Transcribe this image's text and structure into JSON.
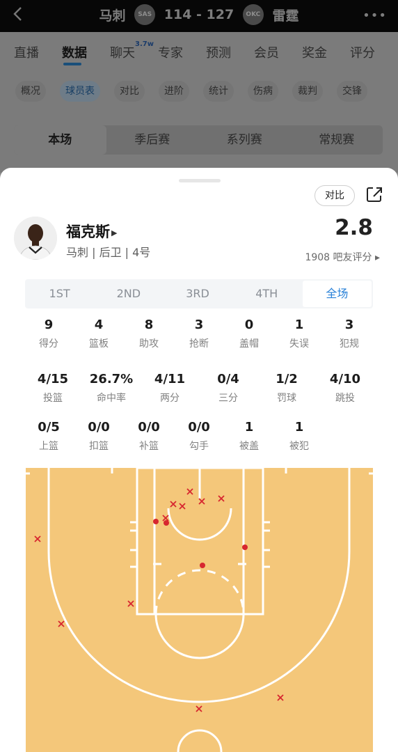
{
  "header": {
    "home_team": "马刺",
    "home_logo": "SAS",
    "score": "114 - 127",
    "away_logo": "OKC",
    "away_team": "雷霆",
    "more_icon": "more-dots-icon",
    "back_icon": "back-arrow-icon"
  },
  "nav_tabs": [
    {
      "label": "直播"
    },
    {
      "label": "数据"
    },
    {
      "label": "聊天",
      "badge": "3.7w"
    },
    {
      "label": "专家"
    },
    {
      "label": "预测"
    },
    {
      "label": "会员"
    },
    {
      "label": "奖金"
    },
    {
      "label": "评分"
    }
  ],
  "sub_tabs": [
    {
      "label": "概况"
    },
    {
      "label": "球员表"
    },
    {
      "label": "对比"
    },
    {
      "label": "进阶"
    },
    {
      "label": "统计"
    },
    {
      "label": "伤病"
    },
    {
      "label": "裁判"
    },
    {
      "label": "交锋"
    }
  ],
  "segments": [
    {
      "label": "本场"
    },
    {
      "label": "季后赛"
    },
    {
      "label": "系列赛"
    },
    {
      "label": "常规赛"
    }
  ],
  "sheet": {
    "compare_label": "对比",
    "share_icon": "share-icon",
    "player": {
      "name": "福克斯",
      "meta": "马刺 | 后卫 | 4号",
      "rating": "2.8",
      "rating_count": "1908 吧友评分 ▸"
    },
    "periods": [
      {
        "label": "1ST"
      },
      {
        "label": "2ND"
      },
      {
        "label": "3RD"
      },
      {
        "label": "4TH"
      },
      {
        "label": "全场"
      }
    ],
    "stats_rows": [
      [
        {
          "value": "9",
          "label": "得分"
        },
        {
          "value": "4",
          "label": "篮板"
        },
        {
          "value": "8",
          "label": "助攻"
        },
        {
          "value": "3",
          "label": "抢断"
        },
        {
          "value": "0",
          "label": "盖帽"
        },
        {
          "value": "1",
          "label": "失误"
        },
        {
          "value": "3",
          "label": "犯规"
        }
      ],
      [
        {
          "value": "4/15",
          "label": "投篮"
        },
        {
          "value": "26.7%",
          "label": "命中率"
        },
        {
          "value": "4/11",
          "label": "两分"
        },
        {
          "value": "0/4",
          "label": "三分"
        },
        {
          "value": "1/2",
          "label": "罚球"
        },
        {
          "value": "4/10",
          "label": "跳投"
        }
      ],
      [
        {
          "value": "0/5",
          "label": "上篮"
        },
        {
          "value": "0/0",
          "label": "扣篮"
        },
        {
          "value": "0/0",
          "label": "补篮"
        },
        {
          "value": "0/0",
          "label": "勾手"
        },
        {
          "value": "1",
          "label": "被盖"
        },
        {
          "value": "1",
          "label": "被犯"
        }
      ]
    ],
    "shot_chart": {
      "colors": {
        "court": "#f4c77a",
        "line": "#ffffff",
        "made": "#d7262f",
        "missed": "#d7262f"
      },
      "shots": [
        {
          "x": -1.4,
          "y": 27.2,
          "result": "missed"
        },
        {
          "x": 0.3,
          "y": 25.8,
          "result": "missed"
        },
        {
          "x": 3.1,
          "y": 26.2,
          "result": "missed"
        },
        {
          "x": -3.8,
          "y": 25.4,
          "result": "missed"
        },
        {
          "x": -2.5,
          "y": 25.1,
          "result": "missed"
        },
        {
          "x": -4.9,
          "y": 23.4,
          "result": "missed"
        },
        {
          "x": -6.3,
          "y": 22.9,
          "result": "made"
        },
        {
          "x": -4.8,
          "y": 22.7,
          "result": "made"
        },
        {
          "x": 6.5,
          "y": 19.2,
          "result": "made"
        },
        {
          "x": 0.4,
          "y": 16.6,
          "result": "made"
        },
        {
          "x": -23.3,
          "y": 20.4,
          "result": "missed"
        },
        {
          "x": -9.9,
          "y": 11.1,
          "result": "missed"
        },
        {
          "x": -19.9,
          "y": 8.2,
          "result": "missed"
        },
        {
          "x": 11.6,
          "y": -2.4,
          "result": "missed"
        },
        {
          "x": -0.1,
          "y": -4.0,
          "result": "missed"
        }
      ]
    }
  }
}
